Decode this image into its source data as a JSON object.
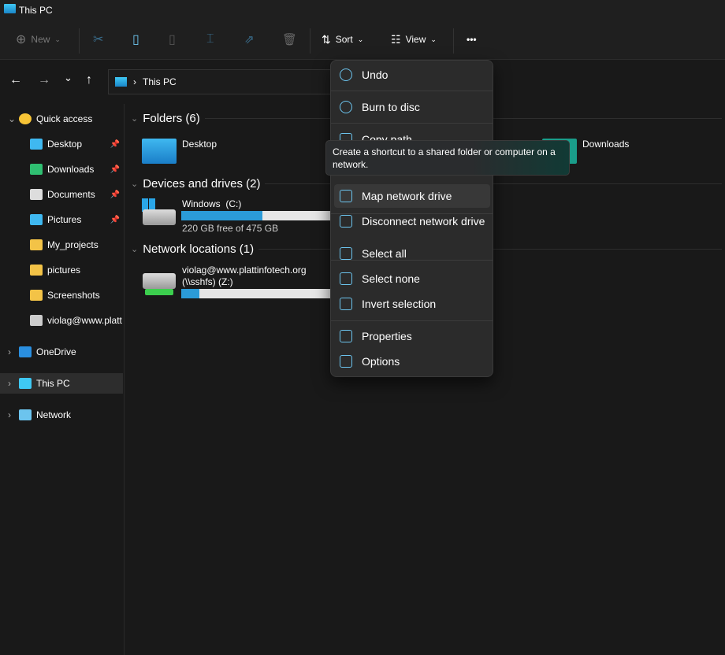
{
  "window": {
    "title": "This PC"
  },
  "toolbar": {
    "new_label": "New",
    "sort_label": "Sort",
    "view_label": "View",
    "more_label": "•••"
  },
  "address": {
    "path": "This PC"
  },
  "sidebar": {
    "items": [
      {
        "label": "Quick access",
        "icon": "star-icon"
      },
      {
        "label": "Desktop",
        "icon": "desktop-icon",
        "pinned": true
      },
      {
        "label": "Downloads",
        "icon": "download-icon",
        "pinned": true
      },
      {
        "label": "Documents",
        "icon": "document-icon",
        "pinned": true
      },
      {
        "label": "Pictures",
        "icon": "pictures-icon",
        "pinned": true
      },
      {
        "label": "My_projects",
        "icon": "folder-icon"
      },
      {
        "label": "pictures",
        "icon": "folder-icon"
      },
      {
        "label": "Screenshots",
        "icon": "folder-icon"
      },
      {
        "label": "violag@www.platt",
        "icon": "network-drive-icon"
      },
      {
        "label": "OneDrive",
        "icon": "cloud-icon"
      },
      {
        "label": "This PC",
        "icon": "computer-icon",
        "selected": true
      },
      {
        "label": "Network",
        "icon": "network-icon"
      }
    ]
  },
  "main": {
    "folders_header": "Folders (6)",
    "folders": [
      {
        "label": "Desktop"
      },
      {
        "label": "Downloads"
      }
    ],
    "devices_header": "Devices and drives (2)",
    "drive_c": {
      "name": "Windows  (C:)",
      "free": "220 GB free of 475 GB",
      "used_fraction": 0.54
    },
    "network_header": "Network locations (1)",
    "drive_z": {
      "name": "violag@www.plattinfotech.org",
      "name2": "(\\\\sshfs) (Z:)",
      "used_fraction": 0.12
    }
  },
  "menu": {
    "items": [
      {
        "label": "Undo"
      },
      {
        "label": "Burn to disc"
      },
      {
        "label": "Copy path"
      },
      {
        "label": "Map network drive",
        "hovered": true
      },
      {
        "label": "Disconnect network drive"
      },
      {
        "label": "Select all"
      },
      {
        "label": "Select none"
      },
      {
        "label": "Invert selection"
      },
      {
        "label": "Properties"
      },
      {
        "label": "Options"
      }
    ]
  },
  "tooltip": {
    "text": "Create a shortcut to a shared folder or computer on a network."
  },
  "colors": {
    "accent": "#2b9bd8",
    "background": "#191919",
    "menu": "#2b2b2b"
  }
}
